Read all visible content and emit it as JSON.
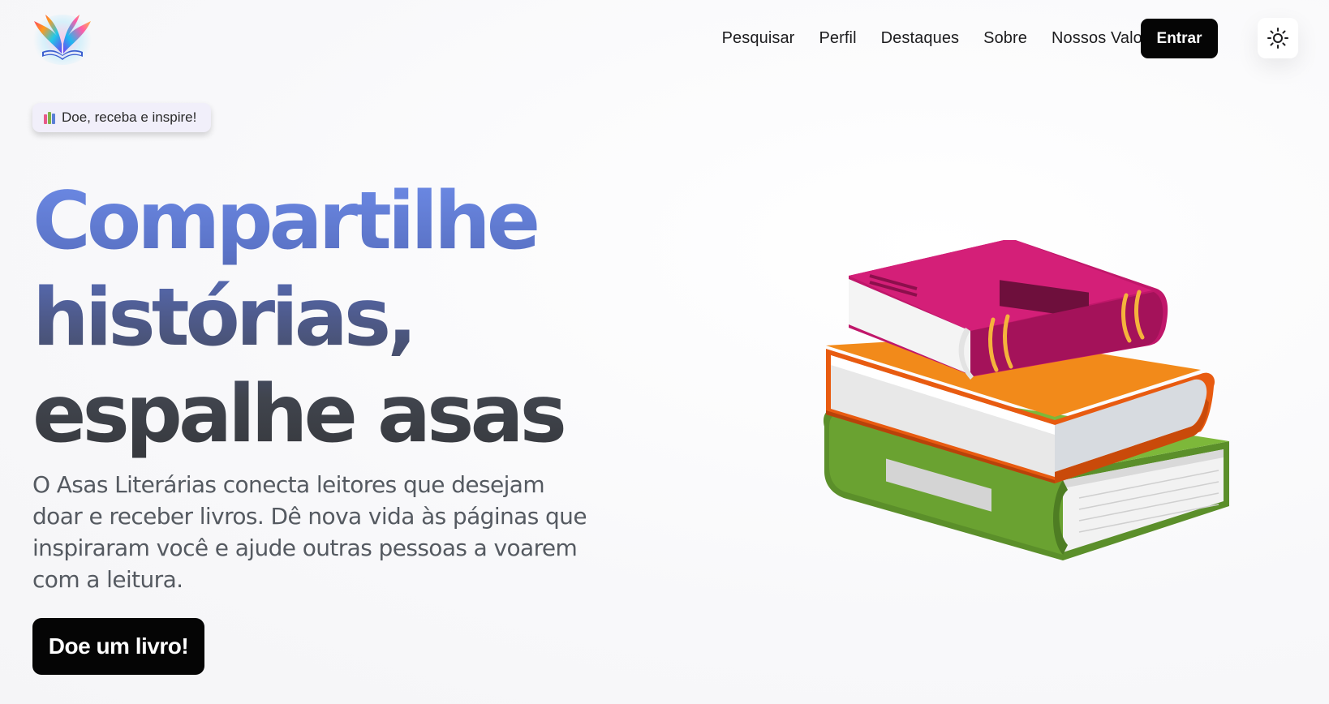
{
  "header": {
    "logo_icon": "winged-book-icon",
    "nav": [
      {
        "label": "Pesquisar"
      },
      {
        "label": "Perfil"
      },
      {
        "label": "Destaques"
      },
      {
        "label": "Sobre"
      },
      {
        "label": "Nossos Valores"
      }
    ],
    "login_label": "Entrar",
    "theme_icon": "sun-icon"
  },
  "hero": {
    "badge_icon": "books-emoji-icon",
    "badge_text": "Doe, receba e inspire!",
    "title_lines": [
      "Compartilhe",
      "histórias,",
      "espalhe asas"
    ],
    "description": "O Asas Literárias conecta leitores que desejam doar e receber livros. Dê nova vida às páginas que inspiraram você e ajude outras pessoas a voarem com a leitura.",
    "cta_label": "Doe um livro!",
    "illustration": "stacked-books-illustration"
  },
  "colors": {
    "primary_button": "#050505",
    "headline_gradient_top": "#6d8be7",
    "headline_gradient_bottom": "#36383c",
    "book_top": "#a0175e",
    "book_middle": "#e8620e",
    "book_bottom": "#6fa334"
  }
}
